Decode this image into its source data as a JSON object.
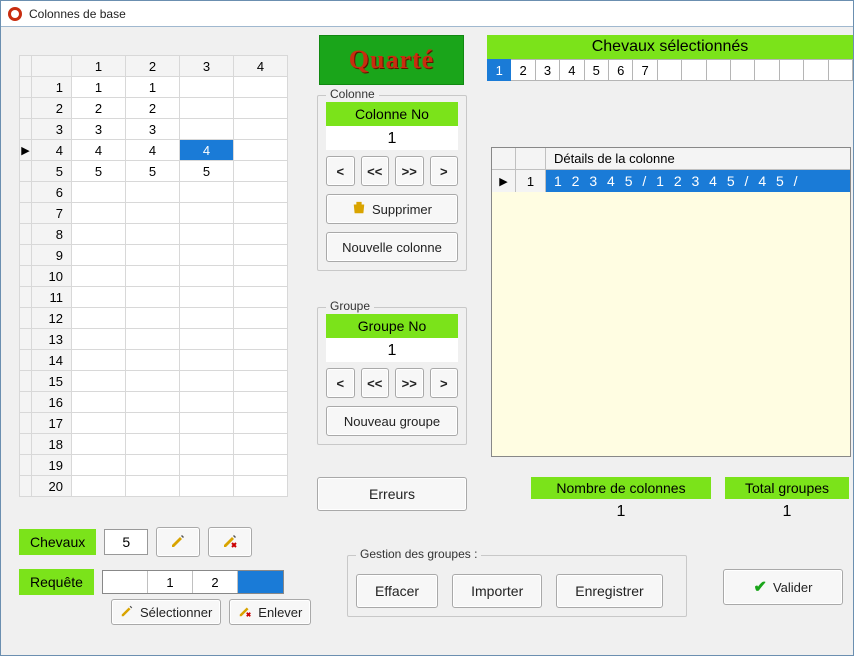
{
  "window": {
    "title": "Colonnes de base"
  },
  "logo_text": "Quarté",
  "grid": {
    "col_headers": [
      "1",
      "2",
      "3",
      "4"
    ],
    "row_count": 20,
    "current_row": 4,
    "selected_cell": {
      "row": 4,
      "col": 3
    },
    "cells": {
      "1": [
        "1",
        "1",
        "",
        ""
      ],
      "2": [
        "2",
        "2",
        "",
        ""
      ],
      "3": [
        "3",
        "3",
        "",
        ""
      ],
      "4": [
        "4",
        "4",
        "4",
        ""
      ],
      "5": [
        "5",
        "5",
        "5",
        ""
      ]
    }
  },
  "colonne": {
    "legend": "Colonne",
    "title": "Colonne No",
    "value": "1",
    "nav": {
      "first": "<",
      "prev": "<<",
      "next": ">>",
      "last": ">"
    },
    "supprimer": "Supprimer",
    "nouvelle": "Nouvelle colonne"
  },
  "groupe": {
    "legend": "Groupe",
    "title": "Groupe No",
    "value": "1",
    "nav": {
      "first": "<",
      "prev": "<<",
      "next": ">>",
      "last": ">"
    },
    "nouveau": "Nouveau groupe"
  },
  "erreurs": "Erreurs",
  "top": {
    "title": "Chevaux sélectionnés",
    "cells": [
      "1",
      "2",
      "3",
      "4",
      "5",
      "6",
      "7",
      "",
      "",
      "",
      "",
      "",
      "",
      "",
      ""
    ],
    "selected_index": 0
  },
  "details": {
    "header": "Détails de la colonne",
    "row_no": "1",
    "row_text": "1 2 3 4 5 / 1 2 3 4 5 / 4 5 /"
  },
  "summary": {
    "colonnes_label": "Nombre de colonnes",
    "colonnes_value": "1",
    "groupes_label": "Total groupes",
    "groupes_value": "1"
  },
  "chevaux": {
    "label": "Chevaux",
    "value": "5"
  },
  "requete": {
    "label": "Requête",
    "cells": [
      "",
      "1",
      "2",
      ""
    ],
    "selectionner": "Sélectionner",
    "enlever": "Enlever"
  },
  "gestion": {
    "legend": "Gestion des groupes :",
    "effacer": "Effacer",
    "importer": "Importer",
    "enregistrer": "Enregistrer"
  },
  "valider": "Valider"
}
